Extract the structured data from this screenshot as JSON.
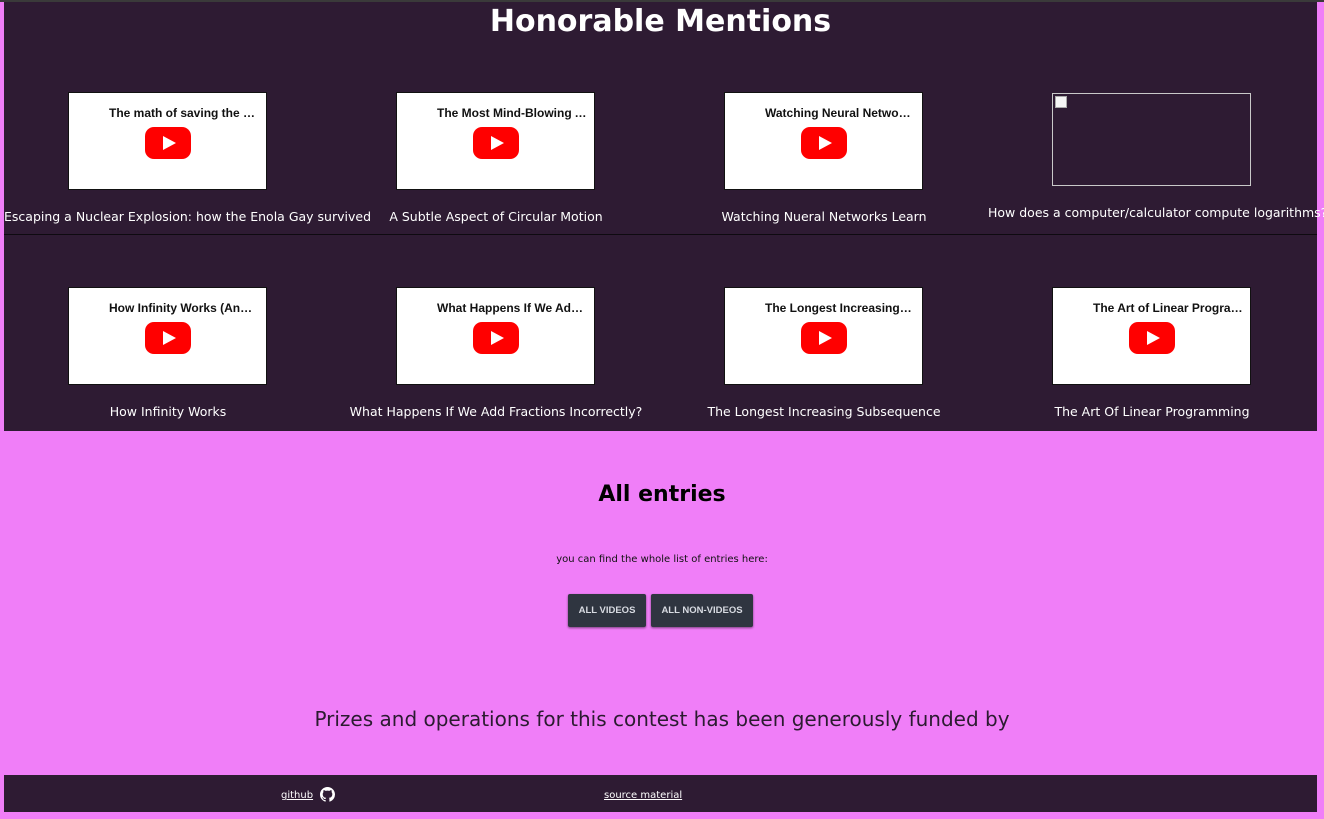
{
  "honorable_mentions": {
    "title": "Honorable Mentions",
    "rows": [
      [
        {
          "thumb_title": "The math of saving the En...",
          "caption": "Escaping a Nuclear Explosion: how the Enola Gay survived",
          "thumb": "youtube"
        },
        {
          "thumb_title": "The Most Mind-Blowing A...",
          "caption": "A Subtle Aspect of Circular Motion",
          "thumb": "youtube"
        },
        {
          "thumb_title": "Watching Neural Network...",
          "caption": "Watching Nueral Networks Learn",
          "thumb": "youtube"
        },
        {
          "thumb_title": "",
          "caption": "How does a computer/calculator compute logarithms?",
          "thumb": "broken-image"
        }
      ],
      [
        {
          "thumb_title": "How Infinity Works (And H...",
          "caption": "How Infinity Works",
          "thumb": "youtube"
        },
        {
          "thumb_title": "What Happens If We Add ...",
          "caption": "What Happens If We Add Fractions Incorrectly?",
          "thumb": "youtube"
        },
        {
          "thumb_title": "The Longest Increasing S...",
          "caption": "The Longest Increasing Subsequence",
          "thumb": "youtube"
        },
        {
          "thumb_title": "The Art of Linear Program...",
          "caption": "The Art Of Linear Programming",
          "thumb": "youtube"
        }
      ]
    ]
  },
  "all_entries": {
    "title": "All entries",
    "text": "you can find the whole list of entries here:",
    "buttons": {
      "videos": "ALL VIDEOS",
      "non_videos": "ALL NON-VIDEOS"
    }
  },
  "funded_text": "Prizes and operations for this contest has been generously funded by",
  "footer": {
    "github_label": "github",
    "github_icon": "github-icon",
    "source_label": "source material"
  },
  "colors": {
    "page_bg": "#f07ef8",
    "section_bg": "#2e1b33",
    "button_bg": "#2f3540",
    "play_red": "#ff0000"
  }
}
